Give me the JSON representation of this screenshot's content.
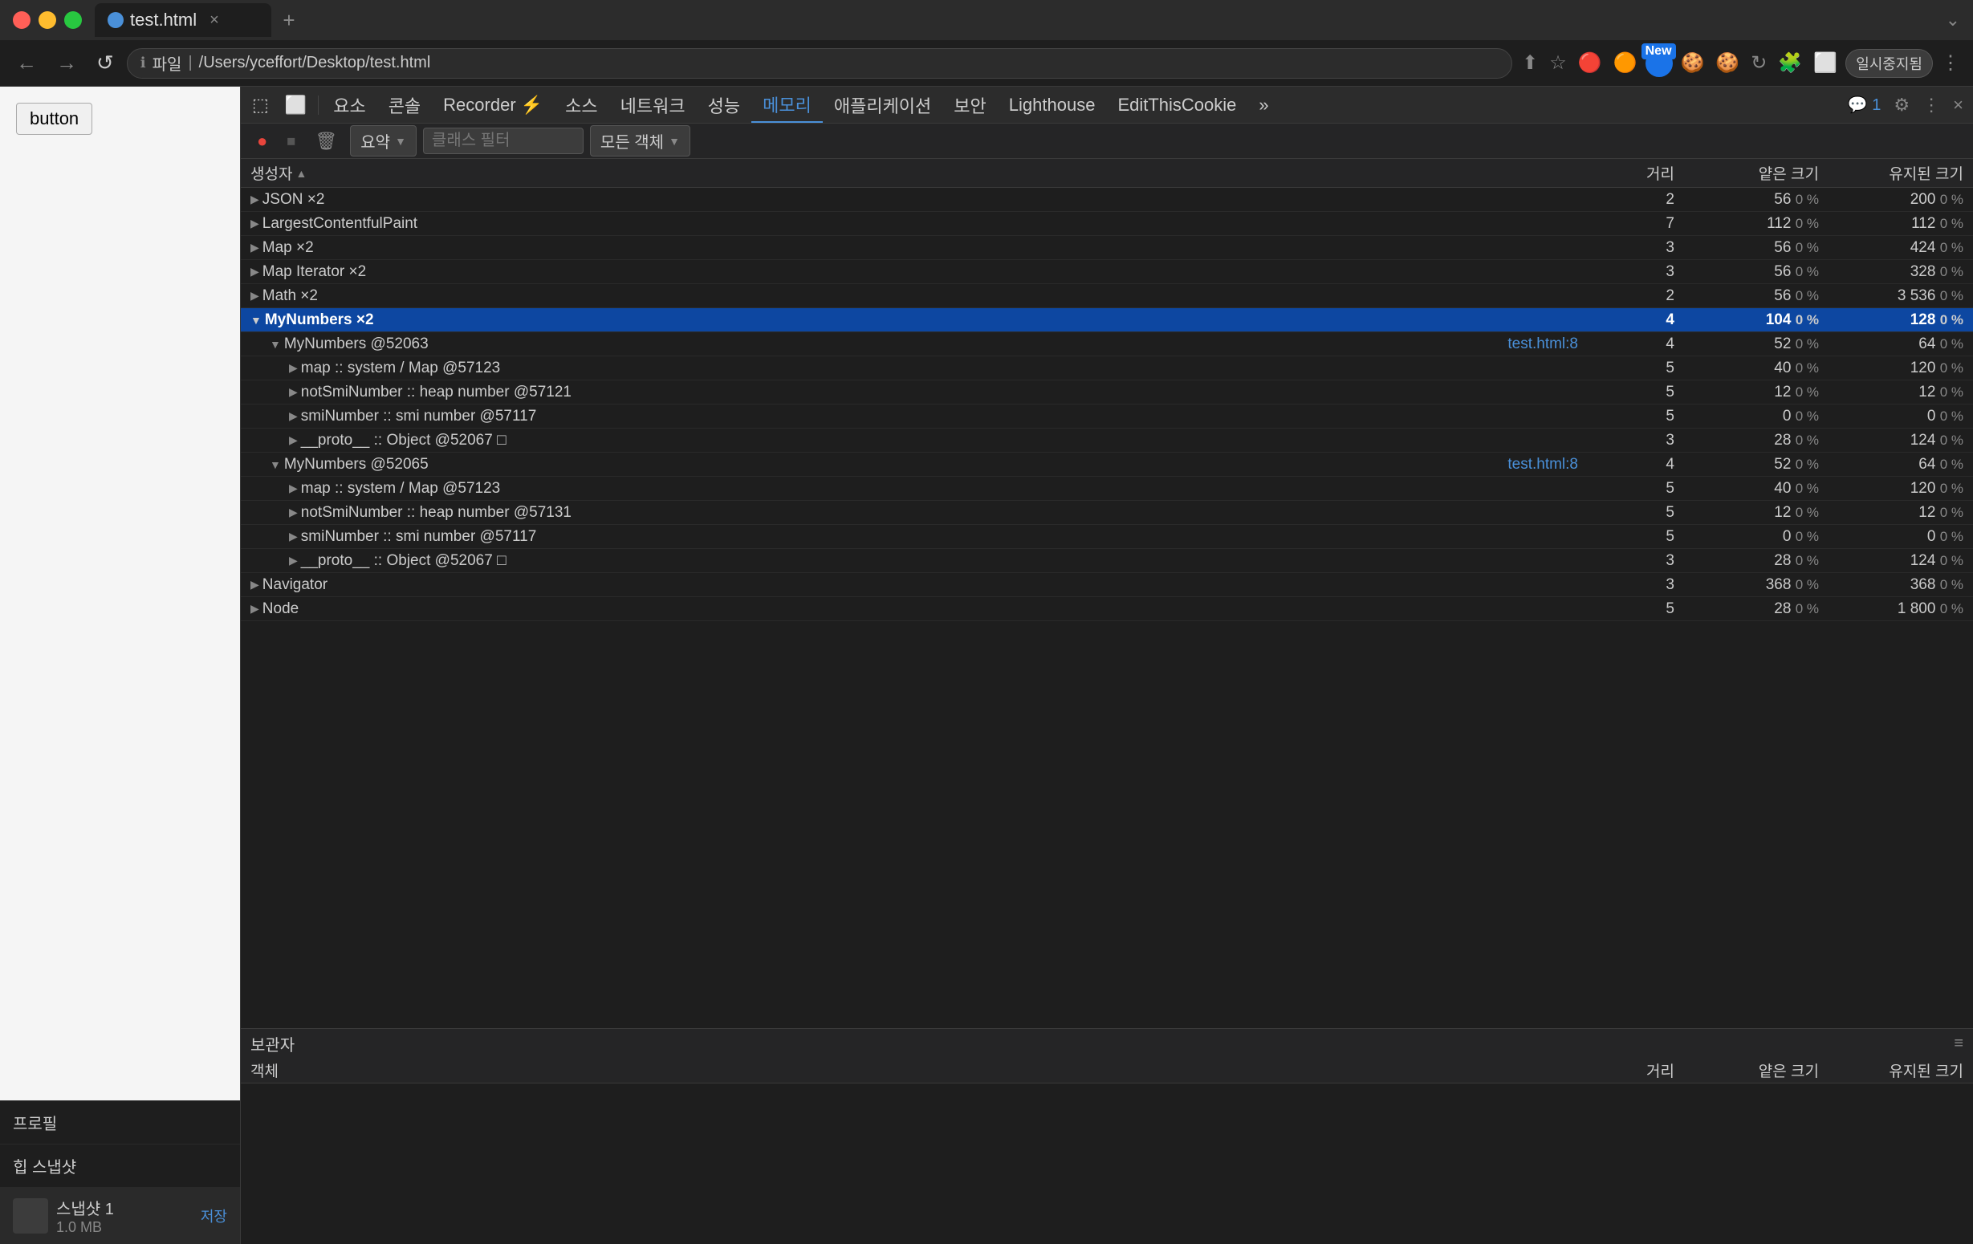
{
  "browser": {
    "tab_title": "test.html",
    "tab_close": "×",
    "tab_add": "+",
    "address": "/Users/yceffort/Desktop/test.html",
    "traffic_lights": [
      "red",
      "yellow",
      "green"
    ]
  },
  "nav": {
    "back": "←",
    "forward": "→",
    "reload": "↺",
    "info_icon": "ℹ",
    "file_label": "파일",
    "address_full": "/Users/yceffort/Desktop/test.html",
    "new_badge": "New"
  },
  "devtools": {
    "tabs": [
      {
        "label": "요소",
        "active": false
      },
      {
        "label": "콘솔",
        "active": false
      },
      {
        "label": "Recorder ⚡",
        "active": false
      },
      {
        "label": "소스",
        "active": false
      },
      {
        "label": "네트워크",
        "active": false
      },
      {
        "label": "성능",
        "active": false
      },
      {
        "label": "메모리",
        "active": true
      },
      {
        "label": "애플리케이션",
        "active": false
      },
      {
        "label": "보안",
        "active": false
      },
      {
        "label": "Lighthouse",
        "active": false
      },
      {
        "label": "EditThisCookie",
        "active": false
      },
      {
        "label": "»",
        "active": false
      }
    ],
    "icons": {
      "inspect": "⬚",
      "device": "⬜",
      "chat_badge": "💬 1",
      "settings": "⚙",
      "more": "⋮",
      "close": "×"
    }
  },
  "memory_toolbar": {
    "record_btn": "●",
    "stop_btn": "⏹",
    "clear_btn": "🗑",
    "summary_label": "요약",
    "filter_placeholder": "클래스 필터",
    "all_objects_label": "모든 객체",
    "dropdown_arrow": "▼"
  },
  "sidebar": {
    "profile_label": "프로필",
    "heap_snapshot_label": "힙 스냅샷",
    "snapshot1_name": "스냅샷 1",
    "snapshot1_size": "1.0 MB",
    "save_label": "저장"
  },
  "table": {
    "headers": [
      {
        "label": "생성자",
        "sortable": true,
        "arrow": "▲"
      },
      {
        "label": "거리",
        "sortable": false
      },
      {
        "label": "얕은 크기",
        "sortable": false
      },
      {
        "label": "유지된 크기",
        "sortable": false
      }
    ],
    "rows": [
      {
        "name": "JSON  ×2",
        "indent": 0,
        "expand": true,
        "distance": "2",
        "shallow": "56",
        "shallow_pct": "0 %",
        "retained": "200",
        "retained_pct": "0 %",
        "selected": false
      },
      {
        "name": "LargestContentfulPaint",
        "indent": 0,
        "expand": true,
        "distance": "7",
        "shallow": "112",
        "shallow_pct": "0 %",
        "retained": "112",
        "retained_pct": "0 %",
        "selected": false
      },
      {
        "name": "Map  ×2",
        "indent": 0,
        "expand": true,
        "distance": "3",
        "shallow": "56",
        "shallow_pct": "0 %",
        "retained": "424",
        "retained_pct": "0 %",
        "selected": false
      },
      {
        "name": "Map Iterator  ×2",
        "indent": 0,
        "expand": true,
        "distance": "3",
        "shallow": "56",
        "shallow_pct": "0 %",
        "retained": "328",
        "retained_pct": "0 %",
        "selected": false
      },
      {
        "name": "Math  ×2",
        "indent": 0,
        "expand": true,
        "distance": "2",
        "shallow": "56",
        "shallow_pct": "0 %",
        "retained": "3 536",
        "retained_pct": "0 %",
        "selected": false
      },
      {
        "name": "MyNumbers  ×2",
        "indent": 0,
        "expand": true,
        "distance": "4",
        "shallow": "104",
        "shallow_pct": "0 %",
        "retained": "128",
        "retained_pct": "0 %",
        "selected": true
      },
      {
        "name": "MyNumbers @52063",
        "indent": 1,
        "expand": true,
        "distance": "4",
        "link": "test.html:8",
        "shallow": "52",
        "shallow_pct": "0 %",
        "retained": "64",
        "retained_pct": "0 %",
        "selected": false
      },
      {
        "name": "map :: system / Map @57123",
        "indent": 2,
        "expand": true,
        "distance": "5",
        "shallow": "40",
        "shallow_pct": "0 %",
        "retained": "120",
        "retained_pct": "0 %",
        "selected": false
      },
      {
        "name": "notSmiNumber :: heap number @57121",
        "indent": 2,
        "expand": true,
        "distance": "5",
        "shallow": "12",
        "shallow_pct": "0 %",
        "retained": "12",
        "retained_pct": "0 %",
        "selected": false
      },
      {
        "name": "smiNumber :: smi number @57117",
        "indent": 2,
        "expand": true,
        "distance": "5",
        "shallow": "0",
        "shallow_pct": "0 %",
        "retained": "0",
        "retained_pct": "0 %",
        "selected": false
      },
      {
        "name": "__proto__ :: Object @52067 □",
        "indent": 2,
        "expand": true,
        "distance": "3",
        "shallow": "28",
        "shallow_pct": "0 %",
        "retained": "124",
        "retained_pct": "0 %",
        "selected": false
      },
      {
        "name": "MyNumbers @52065",
        "indent": 1,
        "expand": true,
        "distance": "4",
        "link": "test.html:8",
        "shallow": "52",
        "shallow_pct": "0 %",
        "retained": "64",
        "retained_pct": "0 %",
        "selected": false
      },
      {
        "name": "map :: system / Map @57123",
        "indent": 2,
        "expand": true,
        "distance": "5",
        "shallow": "40",
        "shallow_pct": "0 %",
        "retained": "120",
        "retained_pct": "0 %",
        "selected": false
      },
      {
        "name": "notSmiNumber :: heap number @57131",
        "indent": 2,
        "expand": true,
        "distance": "5",
        "shallow": "12",
        "shallow_pct": "0 %",
        "retained": "12",
        "retained_pct": "0 %",
        "selected": false
      },
      {
        "name": "smiNumber :: smi number @57117",
        "indent": 2,
        "expand": true,
        "distance": "5",
        "shallow": "0",
        "shallow_pct": "0 %",
        "retained": "0",
        "retained_pct": "0 %",
        "selected": false
      },
      {
        "name": "__proto__ :: Object @52067 □",
        "indent": 2,
        "expand": true,
        "distance": "3",
        "shallow": "28",
        "shallow_pct": "0 %",
        "retained": "124",
        "retained_pct": "0 %",
        "selected": false
      },
      {
        "name": "Navigator",
        "indent": 0,
        "expand": true,
        "distance": "3",
        "shallow": "368",
        "shallow_pct": "0 %",
        "retained": "368",
        "retained_pct": "0 %",
        "selected": false
      },
      {
        "name": "Node",
        "indent": 0,
        "expand": true,
        "distance": "5",
        "shallow": "28",
        "shallow_pct": "0 %",
        "retained": "1 800",
        "retained_pct": "0 %",
        "selected": false
      }
    ]
  },
  "retainer": {
    "title": "보관자",
    "menu_icon": "≡",
    "headers": [
      {
        "label": "객체"
      },
      {
        "label": "거리"
      },
      {
        "label": "얕은 크기"
      },
      {
        "label": "유지된 크기"
      }
    ]
  },
  "page": {
    "button_label": "button"
  }
}
